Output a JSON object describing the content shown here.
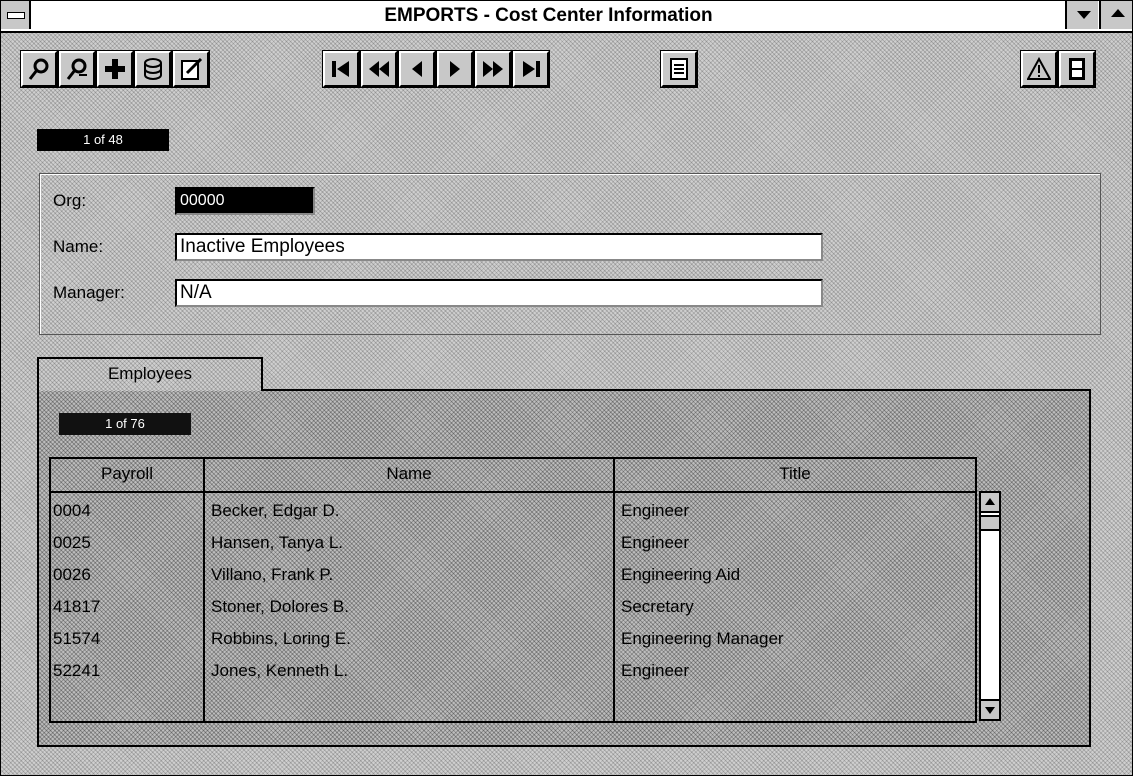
{
  "window": {
    "title": "EMPORTS - Cost Center Information"
  },
  "toolbar": {
    "buttons": [
      {
        "name": "find-icon"
      },
      {
        "name": "find-next-icon"
      },
      {
        "name": "add-icon"
      },
      {
        "name": "database-icon"
      },
      {
        "name": "edit-form-icon"
      },
      {
        "name": "first-record-icon",
        "glyph": "|◀"
      },
      {
        "name": "previous-page-icon",
        "glyph": "◀◀"
      },
      {
        "name": "previous-record-icon",
        "glyph": "◀"
      },
      {
        "name": "next-record-icon",
        "glyph": "▶"
      },
      {
        "name": "next-page-icon",
        "glyph": "▶▶"
      },
      {
        "name": "last-record-icon",
        "glyph": "▶|"
      },
      {
        "name": "report-icon"
      },
      {
        "name": "warning-icon"
      },
      {
        "name": "exit-door-icon"
      }
    ]
  },
  "record_counter": "1 of 48",
  "form": {
    "org_label": "Org:",
    "org_value": "00000",
    "name_label": "Name:",
    "name_value": "Inactive Employees",
    "manager_label": "Manager:",
    "manager_value": "N/A"
  },
  "employees": {
    "tab_label": "Employees",
    "counter": "1 of 76",
    "columns": [
      "Payroll",
      "Name",
      "Title"
    ],
    "rows": [
      {
        "payroll": "0004",
        "name": "Becker, Edgar D.",
        "title": "Engineer"
      },
      {
        "payroll": "0025",
        "name": "Hansen, Tanya L.",
        "title": "Engineer"
      },
      {
        "payroll": "0026",
        "name": "Villano, Frank P.",
        "title": "Engineering Aid"
      },
      {
        "payroll": "41817",
        "name": "Stoner, Dolores B.",
        "title": "Secretary"
      },
      {
        "payroll": "51574",
        "name": "Robbins, Loring E.",
        "title": "Engineering Manager"
      },
      {
        "payroll": "52241",
        "name": "Jones, Kenneth L.",
        "title": "Engineer"
      }
    ]
  }
}
